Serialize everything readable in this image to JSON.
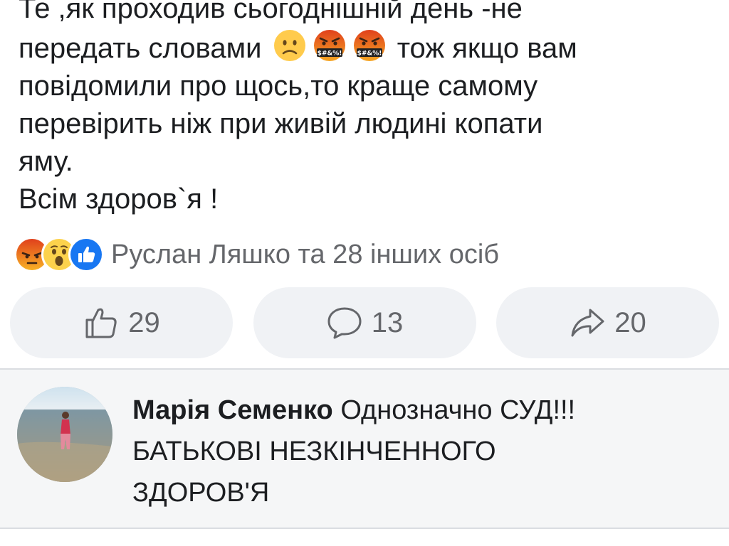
{
  "post": {
    "line1": "Те ,як проходив сьогоднішній день -не",
    "line2_before": "передать словами",
    "line2_after": "тож якщо вам",
    "line3": "повідомили про щось,то краще самому",
    "line4": "перевірить ніж при живій людині копати",
    "line5": "яму.",
    "line6": "Всім здоров`я !",
    "inline_emojis": [
      "slightly-frowning-face-icon",
      "face-with-symbols-on-mouth-icon",
      "face-with-symbols-on-mouth-icon"
    ],
    "symbols_text": "$#&%!"
  },
  "reactions": {
    "icons": [
      "angry-reaction-icon",
      "wow-reaction-icon",
      "like-reaction-icon"
    ],
    "summary": "Руслан Ляшко та 28 інших осіб"
  },
  "actions": {
    "like_count": "29",
    "comment_count": "13",
    "share_count": "20"
  },
  "comment": {
    "author": "Марія Семенко",
    "text_line1": "Однозначно СУД!!!",
    "text_line2": "БАТЬКОВІ НЕЗКІНЧЕННОГО",
    "text_line3": "ЗДОРОВ'Я"
  },
  "colors": {
    "text": "#1c1e21",
    "secondary_text": "#65676b",
    "button_bg": "#f0f2f5",
    "like_blue": "#1877f2",
    "angry_red": "#e9710f",
    "comment_bg": "#f5f6f7"
  }
}
